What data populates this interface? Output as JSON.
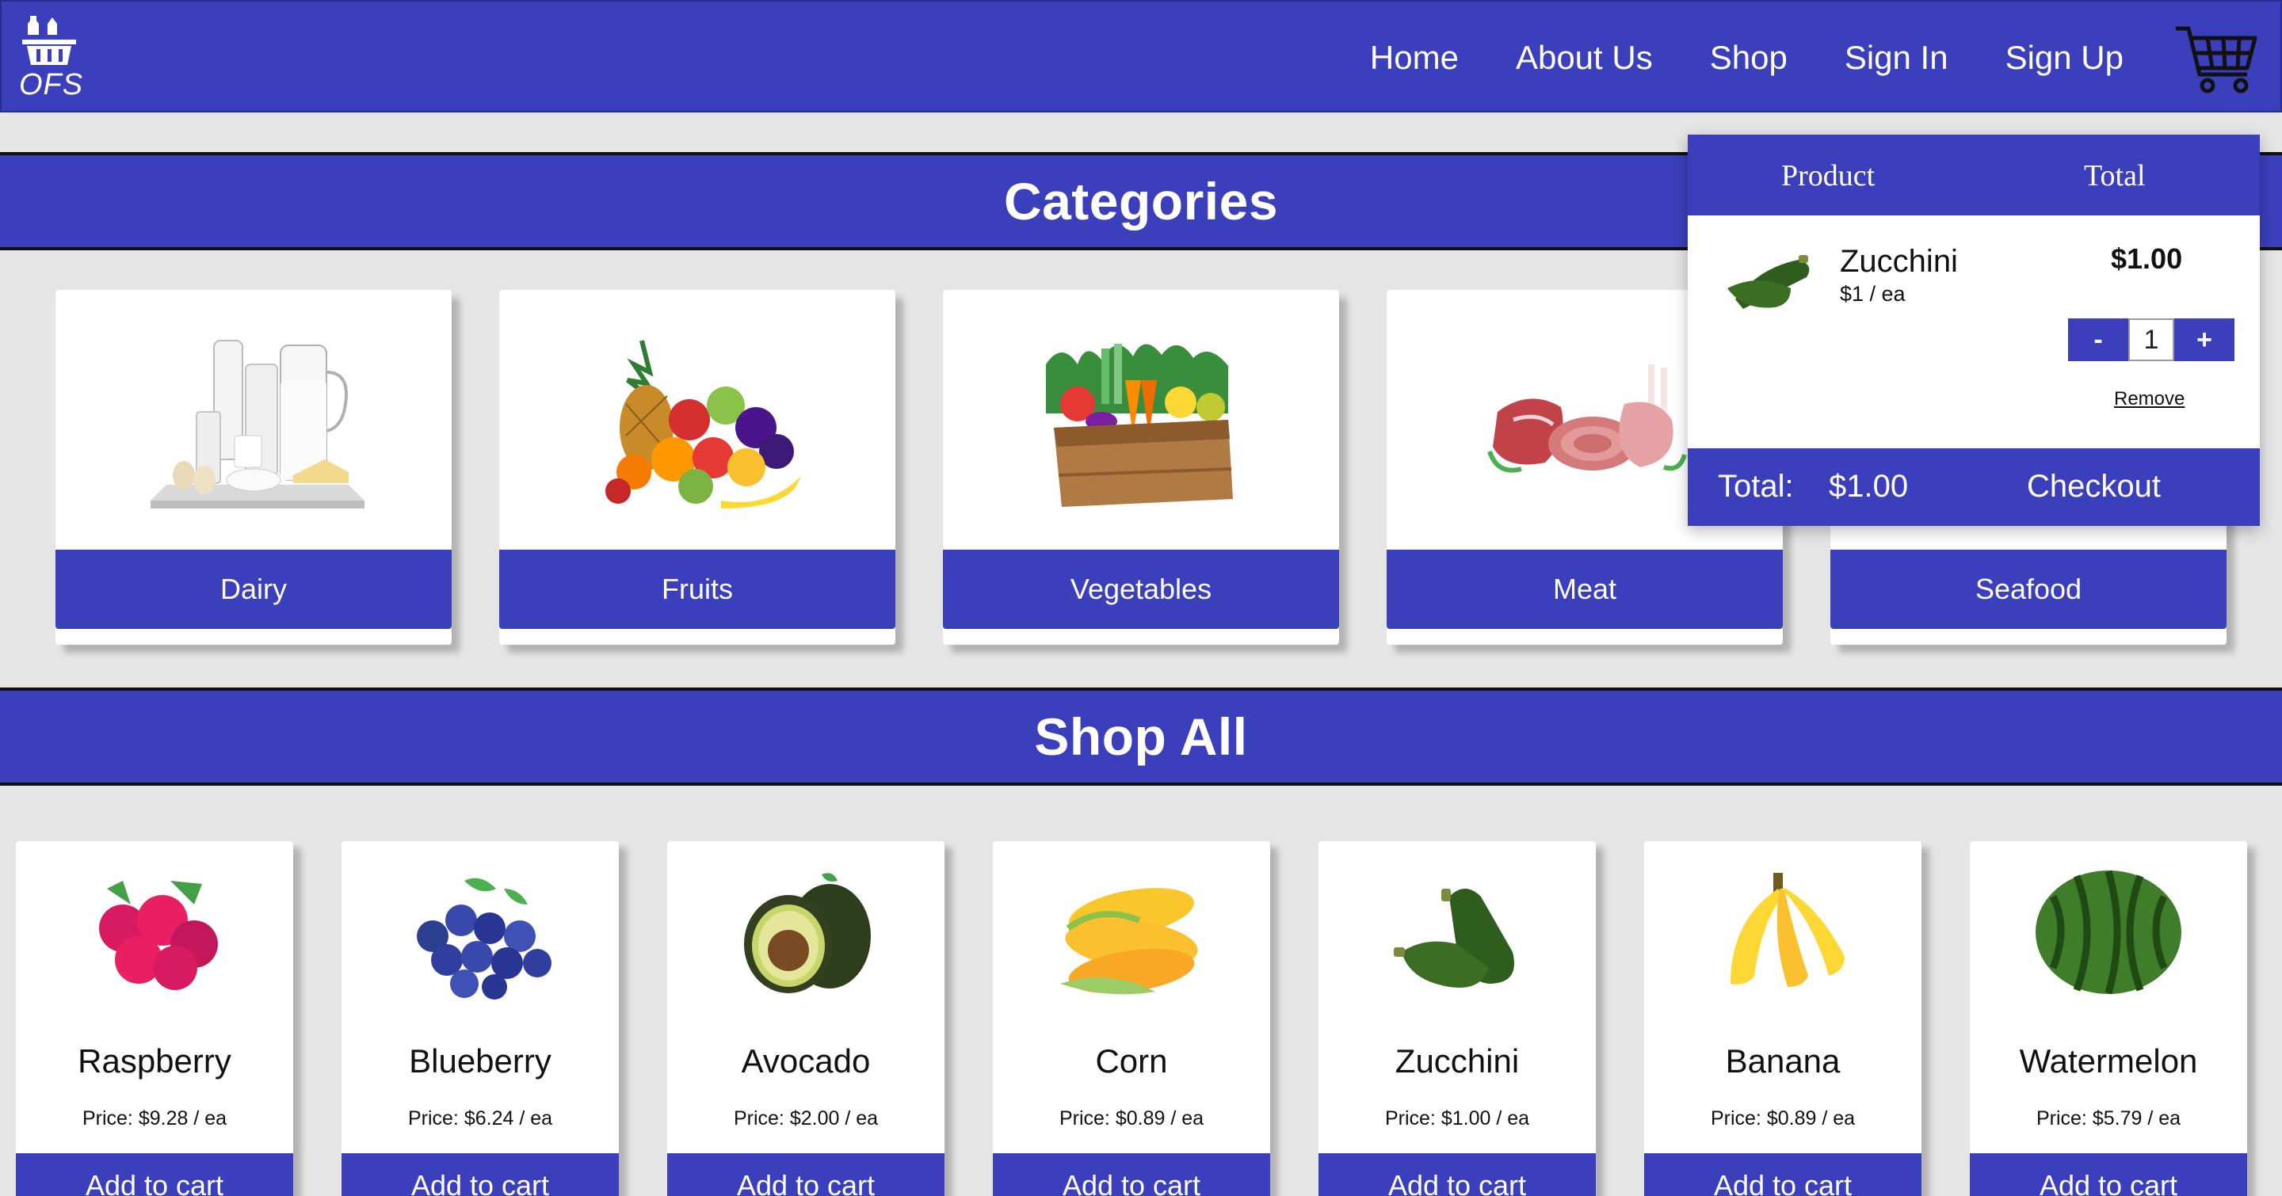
{
  "brand": {
    "logo_text": "OFS"
  },
  "nav": {
    "links": [
      "Home",
      "About Us",
      "Shop",
      "Sign In",
      "Sign Up"
    ]
  },
  "sections": {
    "categories_title": "Categories",
    "shop_all_title": "Shop All"
  },
  "categories": [
    {
      "label": "Dairy",
      "icon": "dairy-image"
    },
    {
      "label": "Fruits",
      "icon": "fruits-image"
    },
    {
      "label": "Vegetables",
      "icon": "vegetables-image"
    },
    {
      "label": "Meat",
      "icon": "meat-image"
    },
    {
      "label": "Seafood",
      "icon": "seafood-image"
    }
  ],
  "products": [
    {
      "name": "Raspberry",
      "price": "Price: $9.28 / ea",
      "button": "Add to cart"
    },
    {
      "name": "Blueberry",
      "price": "Price: $6.24 / ea",
      "button": "Add to cart"
    },
    {
      "name": "Avocado",
      "price": "Price: $2.00 / ea",
      "button": "Add to cart"
    },
    {
      "name": "Corn",
      "price": "Price: $0.89 / ea",
      "button": "Add to cart"
    },
    {
      "name": "Zucchini",
      "price": "Price: $1.00 / ea",
      "button": "Add to cart"
    },
    {
      "name": "Banana",
      "price": "Price: $0.89 / ea",
      "button": "Add to cart"
    },
    {
      "name": "Watermelon",
      "price": "Price: $5.79 / ea",
      "button": "Add to cart"
    }
  ],
  "cart": {
    "header_product": "Product",
    "header_total": "Total",
    "item": {
      "name": "Zucchini",
      "unit_price": "$1 / ea",
      "line_total": "$1.00",
      "quantity": "1",
      "minus_label": "-",
      "plus_label": "+",
      "remove_label": "Remove"
    },
    "footer": {
      "total_label": "Total:",
      "total_value": "$1.00",
      "checkout_label": "Checkout"
    }
  },
  "colors": {
    "brand_blue": "#3b3fbb",
    "page_background": "#e5e5e5"
  }
}
